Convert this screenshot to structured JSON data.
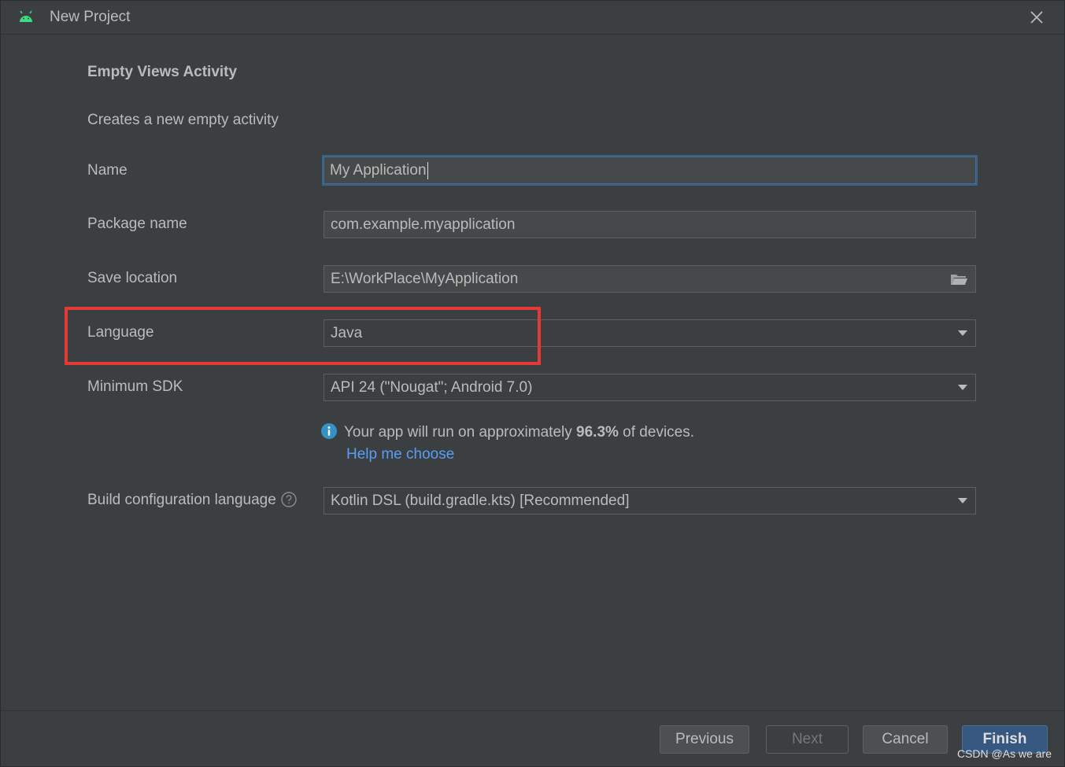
{
  "window": {
    "title": "New Project",
    "icon": "android-icon"
  },
  "template": {
    "heading": "Empty Views Activity",
    "description": "Creates a new empty activity"
  },
  "form": {
    "name": {
      "label": "Name",
      "value": "My Application"
    },
    "package": {
      "label": "Package name",
      "value": "com.example.myapplication"
    },
    "save_location": {
      "label": "Save location",
      "value": "E:\\WorkPlace\\MyApplication",
      "icon": "folder-icon"
    },
    "language": {
      "label": "Language",
      "value": "Java"
    },
    "min_sdk": {
      "label": "Minimum SDK",
      "value": "API 24 (\"Nougat\"; Android 7.0)"
    },
    "info": {
      "prefix": "Your app will run on approximately ",
      "percent": "96.3%",
      "suffix": " of devices.",
      "link": "Help me choose",
      "icon": "info-icon"
    },
    "build_config": {
      "label": "Build configuration language",
      "value": "Kotlin DSL (build.gradle.kts) [Recommended]",
      "icon": "help-circle-icon"
    }
  },
  "buttons": {
    "previous": "Previous",
    "next": "Next",
    "cancel": "Cancel",
    "finish": "Finish"
  },
  "watermark": "CSDN @As we are",
  "colors": {
    "background": "#3c3f41",
    "highlight": "#e53935",
    "link": "#589df6",
    "primary_button": "#365880",
    "focus_border": "#3d6185"
  }
}
